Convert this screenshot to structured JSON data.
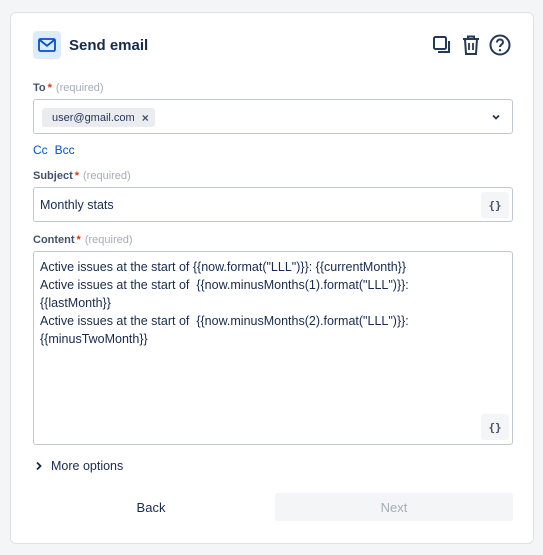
{
  "header": {
    "title": "Send email",
    "icons": [
      "mail-icon",
      "duplicate-icon",
      "delete-icon",
      "help-icon"
    ],
    "accent": "#0052cc"
  },
  "to": {
    "label": "To",
    "required_mark": "*",
    "required_text": "(required)",
    "recipients": [
      "user@gmail.com"
    ],
    "remove_glyph": "×"
  },
  "cc": {
    "cc_label": "Cc",
    "bcc_label": "Bcc"
  },
  "subject": {
    "label": "Subject",
    "required_mark": "*",
    "required_text": "(required)",
    "value": "Monthly stats",
    "variables_button": "{}"
  },
  "content": {
    "label": "Content",
    "required_mark": "*",
    "required_text": "(required)",
    "value": "Active issues at the start of {{now.format(\"LLL\")}}: {{currentMonth}}\nActive issues at the start of  {{now.minusMonths(1).format(\"LLL\")}}:\n{{lastMonth}}\nActive issues at the start of  {{now.minusMonths(2).format(\"LLL\")}}:\n{{minusTwoMonth}}",
    "variables_button": "{}"
  },
  "more_options": {
    "label": "More options"
  },
  "footer": {
    "back_label": "Back",
    "next_label": "Next",
    "next_disabled": true
  }
}
